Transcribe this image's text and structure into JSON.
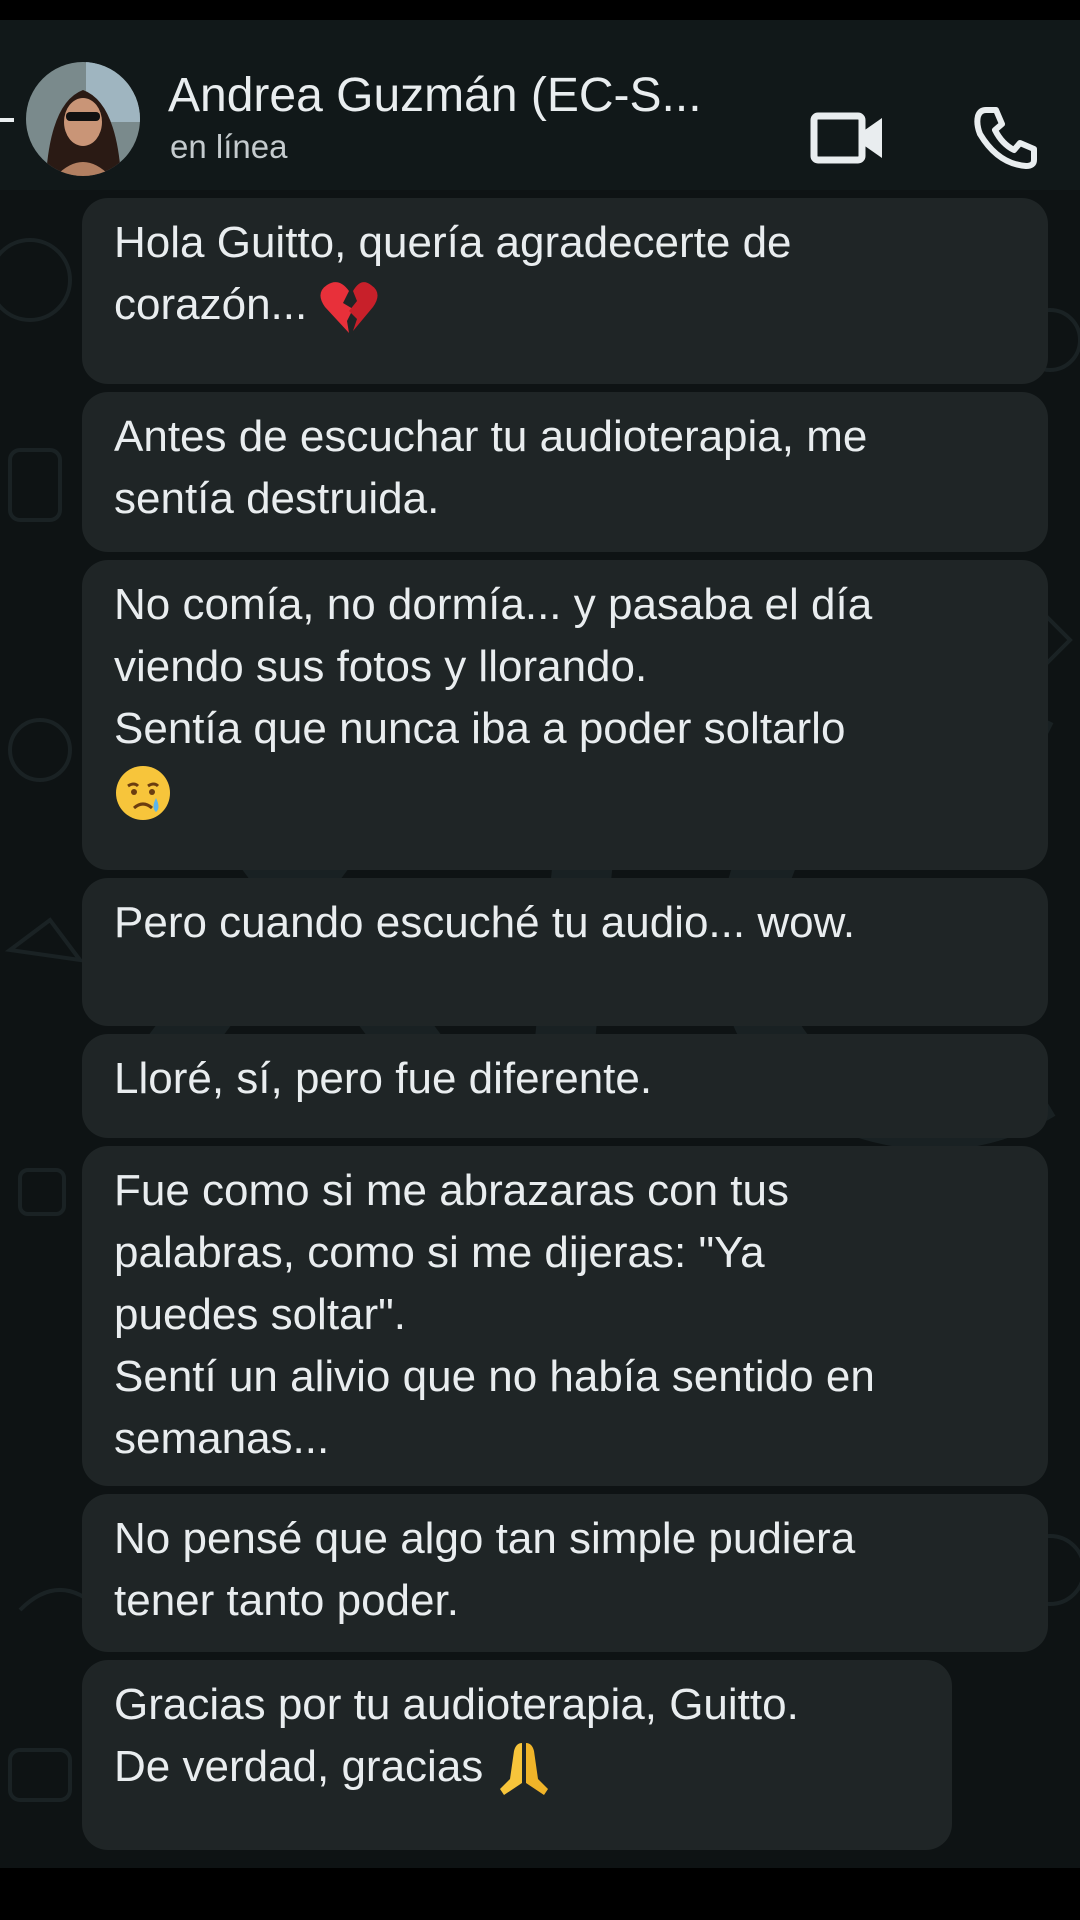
{
  "header": {
    "contact_name": "Andrea Guzmán (EC-S...",
    "status": "en línea",
    "icons": [
      "back-arrow-icon",
      "video-call-icon",
      "voice-call-icon"
    ]
  },
  "colors": {
    "header_bg": "#111819",
    "chat_bg": "#0e1314",
    "bubble_bg": "#1f2526",
    "text": "#e9edef",
    "subtext": "#c5cbce"
  },
  "messages": [
    {
      "text": "Hola Guitto, quería agradecerte de\ncorazón...",
      "emoji": "broken-heart-icon"
    },
    {
      "text": "Antes de escuchar tu audioterapia, me\nsentía destruida."
    },
    {
      "text": "No comía, no dormía... y pasaba el día\nviendo sus fotos y llorando.\nSentía que nunca iba a poder soltarlo",
      "emoji": "crying-face-icon"
    },
    {
      "text": "Pero cuando escuché tu audio... wow."
    },
    {
      "text": "Lloré, sí, pero fue diferente."
    },
    {
      "text": "Fue como si me abrazaras con tus\npalabras, como si me dijeras: \"Ya\npuedes soltar\".\nSentí un alivio que no había sentido en\nsemanas..."
    },
    {
      "text": "No pensé que algo tan simple pudiera\ntener tanto poder."
    },
    {
      "text": "Gracias por tu audioterapia, Guitto.\nDe verdad, gracias",
      "emoji": "folded-hands-icon"
    }
  ]
}
